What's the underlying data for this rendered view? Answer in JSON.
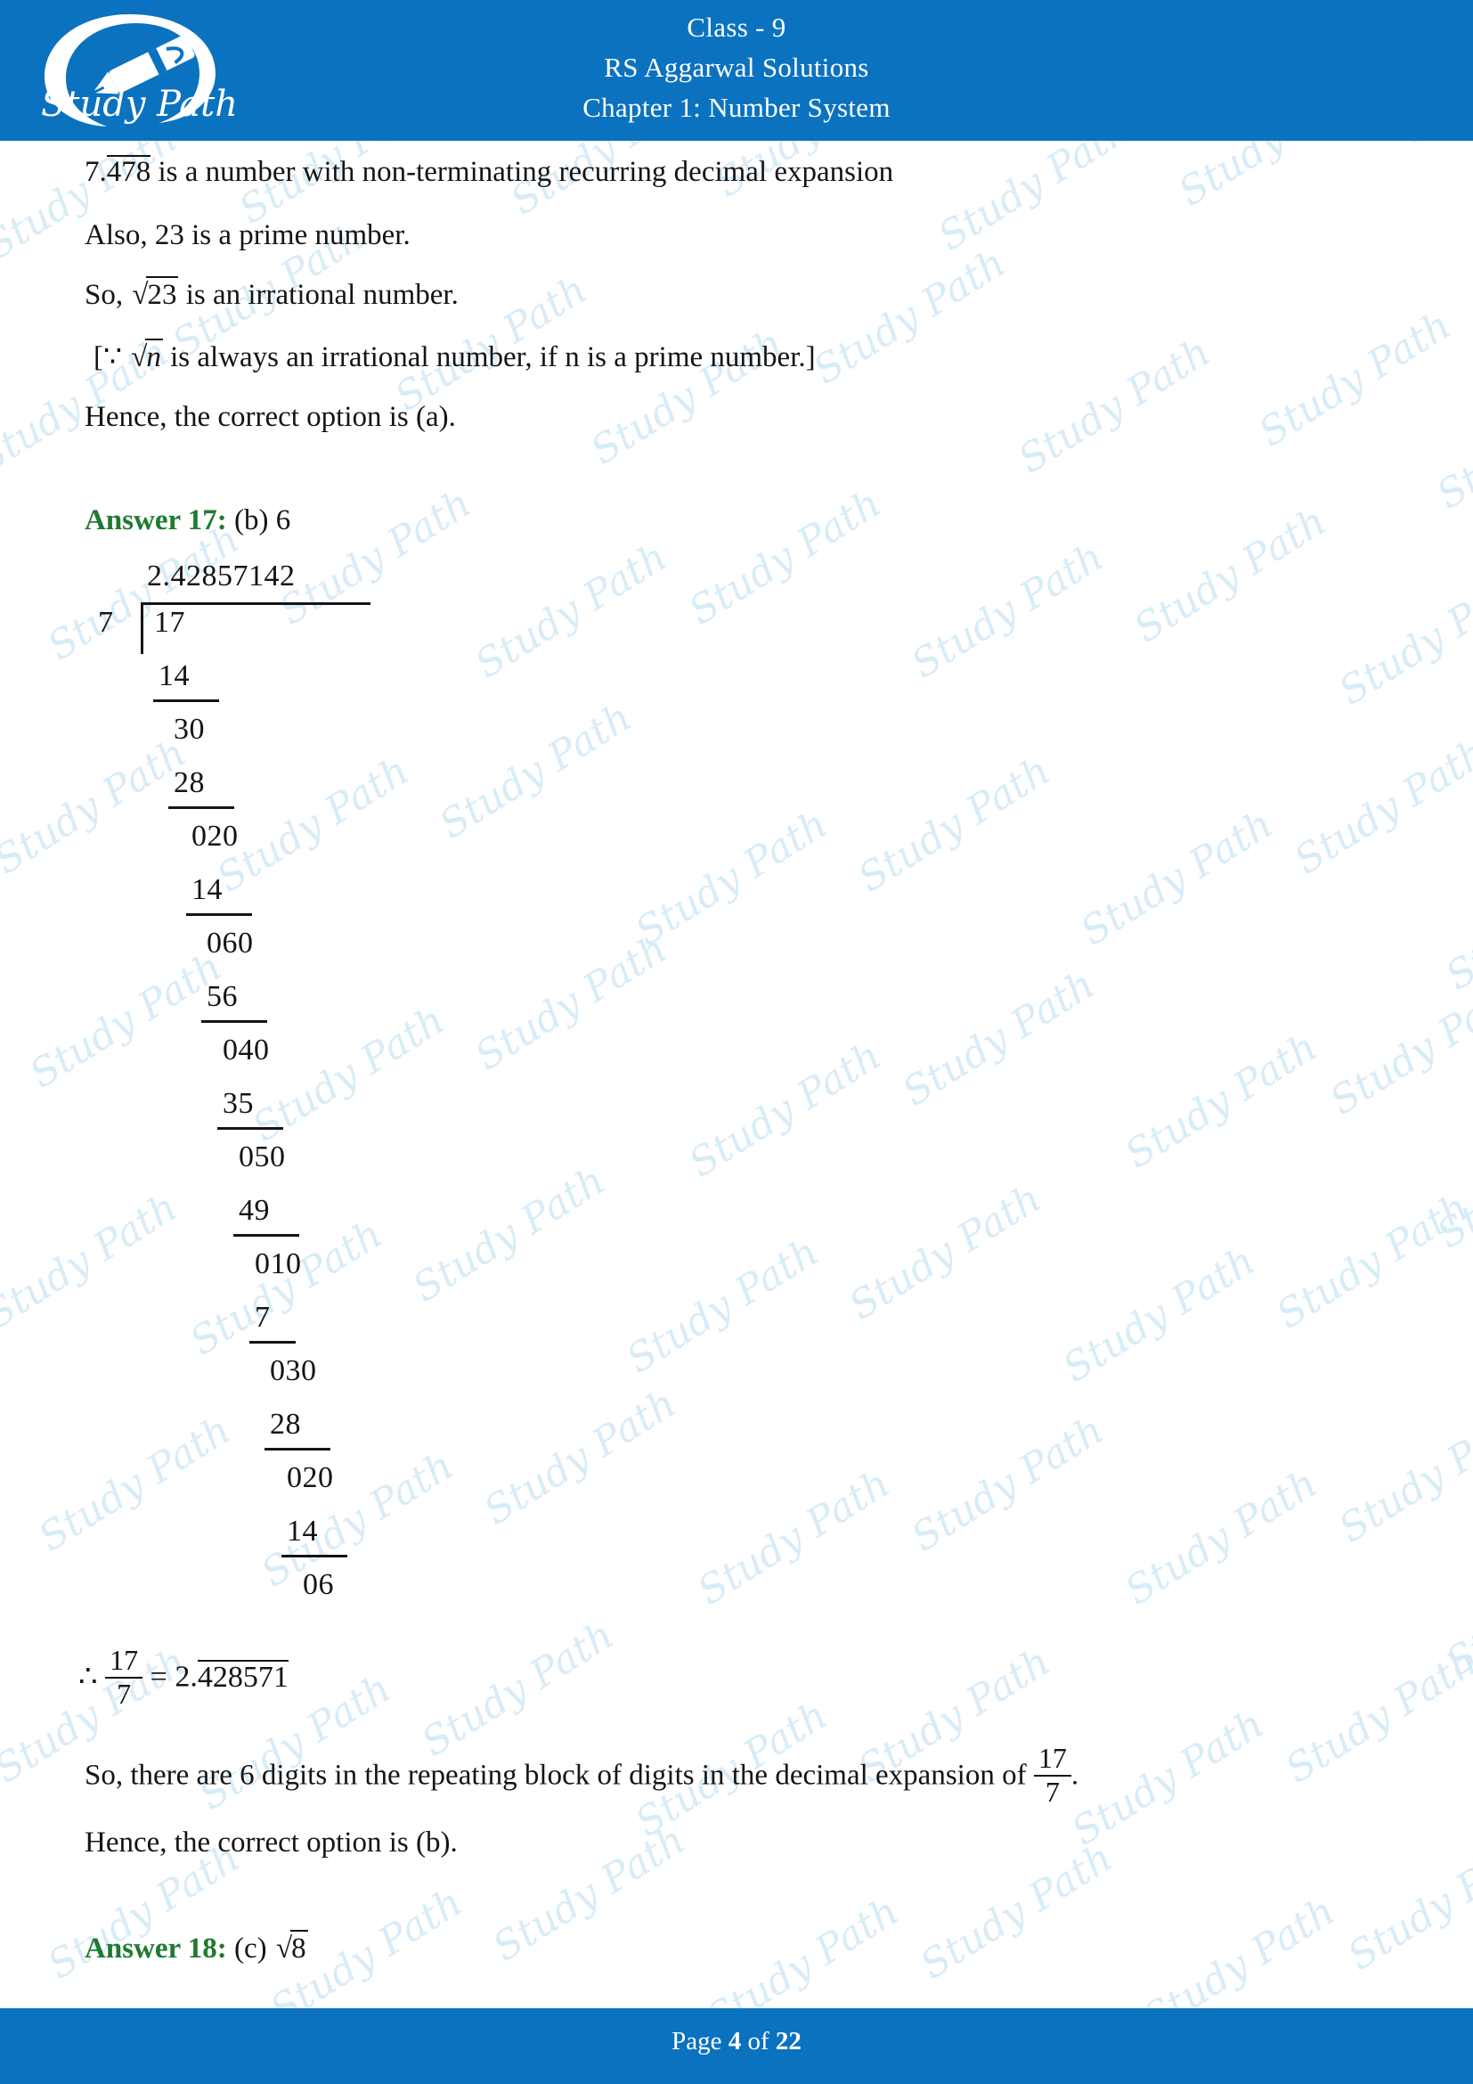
{
  "header": {
    "logo_text": "Study Path",
    "line1": "Class - 9",
    "line2": "RS Aggarwal Solutions",
    "line3": "Chapter 1: Number System"
  },
  "footer": {
    "prefix": "Page ",
    "page": "4",
    "middle": " of ",
    "total": "22"
  },
  "watermark": {
    "text": "Study Path"
  },
  "body": {
    "line_478_prefix": "7.",
    "line_478_overline": "478",
    "line_478_suffix": " is a number with non-terminating recurring decimal expansion",
    "line_prime": "Also, 23 is a prime number.",
    "line_so_prefix": "So, ",
    "line_so_radicand": "23",
    "line_so_suffix": " is an irrational number.",
    "line_bracket_open": "[∵ ",
    "line_bracket_radicand": "n",
    "line_bracket_suffix": " is always an irrational number, if n is a prime number.]",
    "line_hence_a": "Hence, the correct option is (a).",
    "answer17_label": "Answer 17:",
    "answer17_value": "(b) 6",
    "conclusion_therefore": "∴",
    "conclusion_num": "17",
    "conclusion_den": "7",
    "conclusion_eq": "=",
    "conclusion_result_prefix": "2.",
    "conclusion_result_overline": "428571",
    "line_digits_part1": "So, there are 6 digits in the repeating block of digits in the decimal expansion of",
    "line_digits_frac_num": "17",
    "line_digits_frac_den": "7",
    "line_digits_part2": ".",
    "line_hence_b": "Hence, the correct option is (b).",
    "answer18_label": "Answer 18:",
    "answer18_value_prefix": "(c) ",
    "answer18_radicand": "8"
  },
  "long_division": {
    "quotient": "2.42857142",
    "divisor": "7",
    "dividend": "17",
    "steps": [
      {
        "value": "14",
        "underlined": true
      },
      {
        "value": "30",
        "underlined": false
      },
      {
        "value": "28",
        "underlined": true
      },
      {
        "value": "020",
        "underlined": false
      },
      {
        "value": "14",
        "underlined": true
      },
      {
        "value": "060",
        "underlined": false
      },
      {
        "value": "56",
        "underlined": true
      },
      {
        "value": "040",
        "underlined": false
      },
      {
        "value": "35",
        "underlined": true
      },
      {
        "value": "050",
        "underlined": false
      },
      {
        "value": "49",
        "underlined": true
      },
      {
        "value": "010",
        "underlined": false
      },
      {
        "value": "7",
        "underlined": true
      },
      {
        "value": "030",
        "underlined": false
      },
      {
        "value": "28",
        "underlined": true
      },
      {
        "value": "020",
        "underlined": false
      },
      {
        "value": "14",
        "underlined": true
      },
      {
        "value": "06",
        "underlined": false
      }
    ]
  }
}
